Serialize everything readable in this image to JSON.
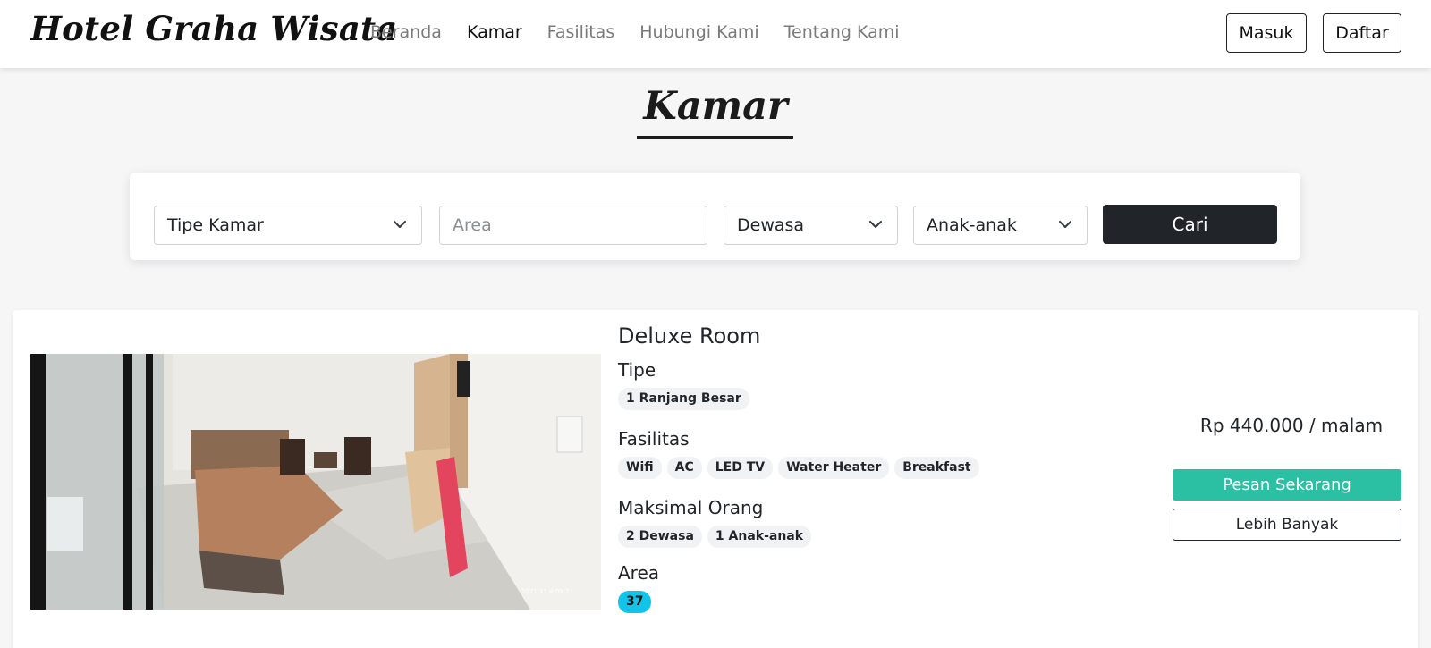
{
  "navbar": {
    "brand": "Hotel Graha Wisata",
    "links": [
      "Beranda",
      "Kamar",
      "Fasilitas",
      "Hubungi Kami",
      "Tentang Kami"
    ],
    "active_link": "Kamar",
    "login_label": "Masuk",
    "register_label": "Daftar"
  },
  "page": {
    "title": "Kamar"
  },
  "search": {
    "room_type": "Tipe Kamar",
    "area_placeholder": "Area",
    "adults": "Dewasa",
    "children": "Anak-anak",
    "button_label": "Cari"
  },
  "room": {
    "name": "Deluxe Room",
    "type_label": "Tipe",
    "types": [
      "1 Ranjang Besar"
    ],
    "facilities_label": "Fasilitas",
    "facilities": [
      "Wifi",
      "AC",
      "LED TV",
      "Water Heater",
      "Breakfast"
    ],
    "max_people_label": "Maksimal Orang",
    "max_people": [
      "2 Dewasa",
      "1 Anak-anak"
    ],
    "area_label": "Area",
    "area_value": "37",
    "photo_timestamp": "2021.11.4  09:27",
    "price": "Rp 440.000 / malam",
    "book_label": "Pesan Sekarang",
    "more_label": "Lebih Banyak"
  },
  "colors": {
    "book_button": "#2bc0a4",
    "search_button": "#212529",
    "area_badge": "#12c3ea"
  }
}
